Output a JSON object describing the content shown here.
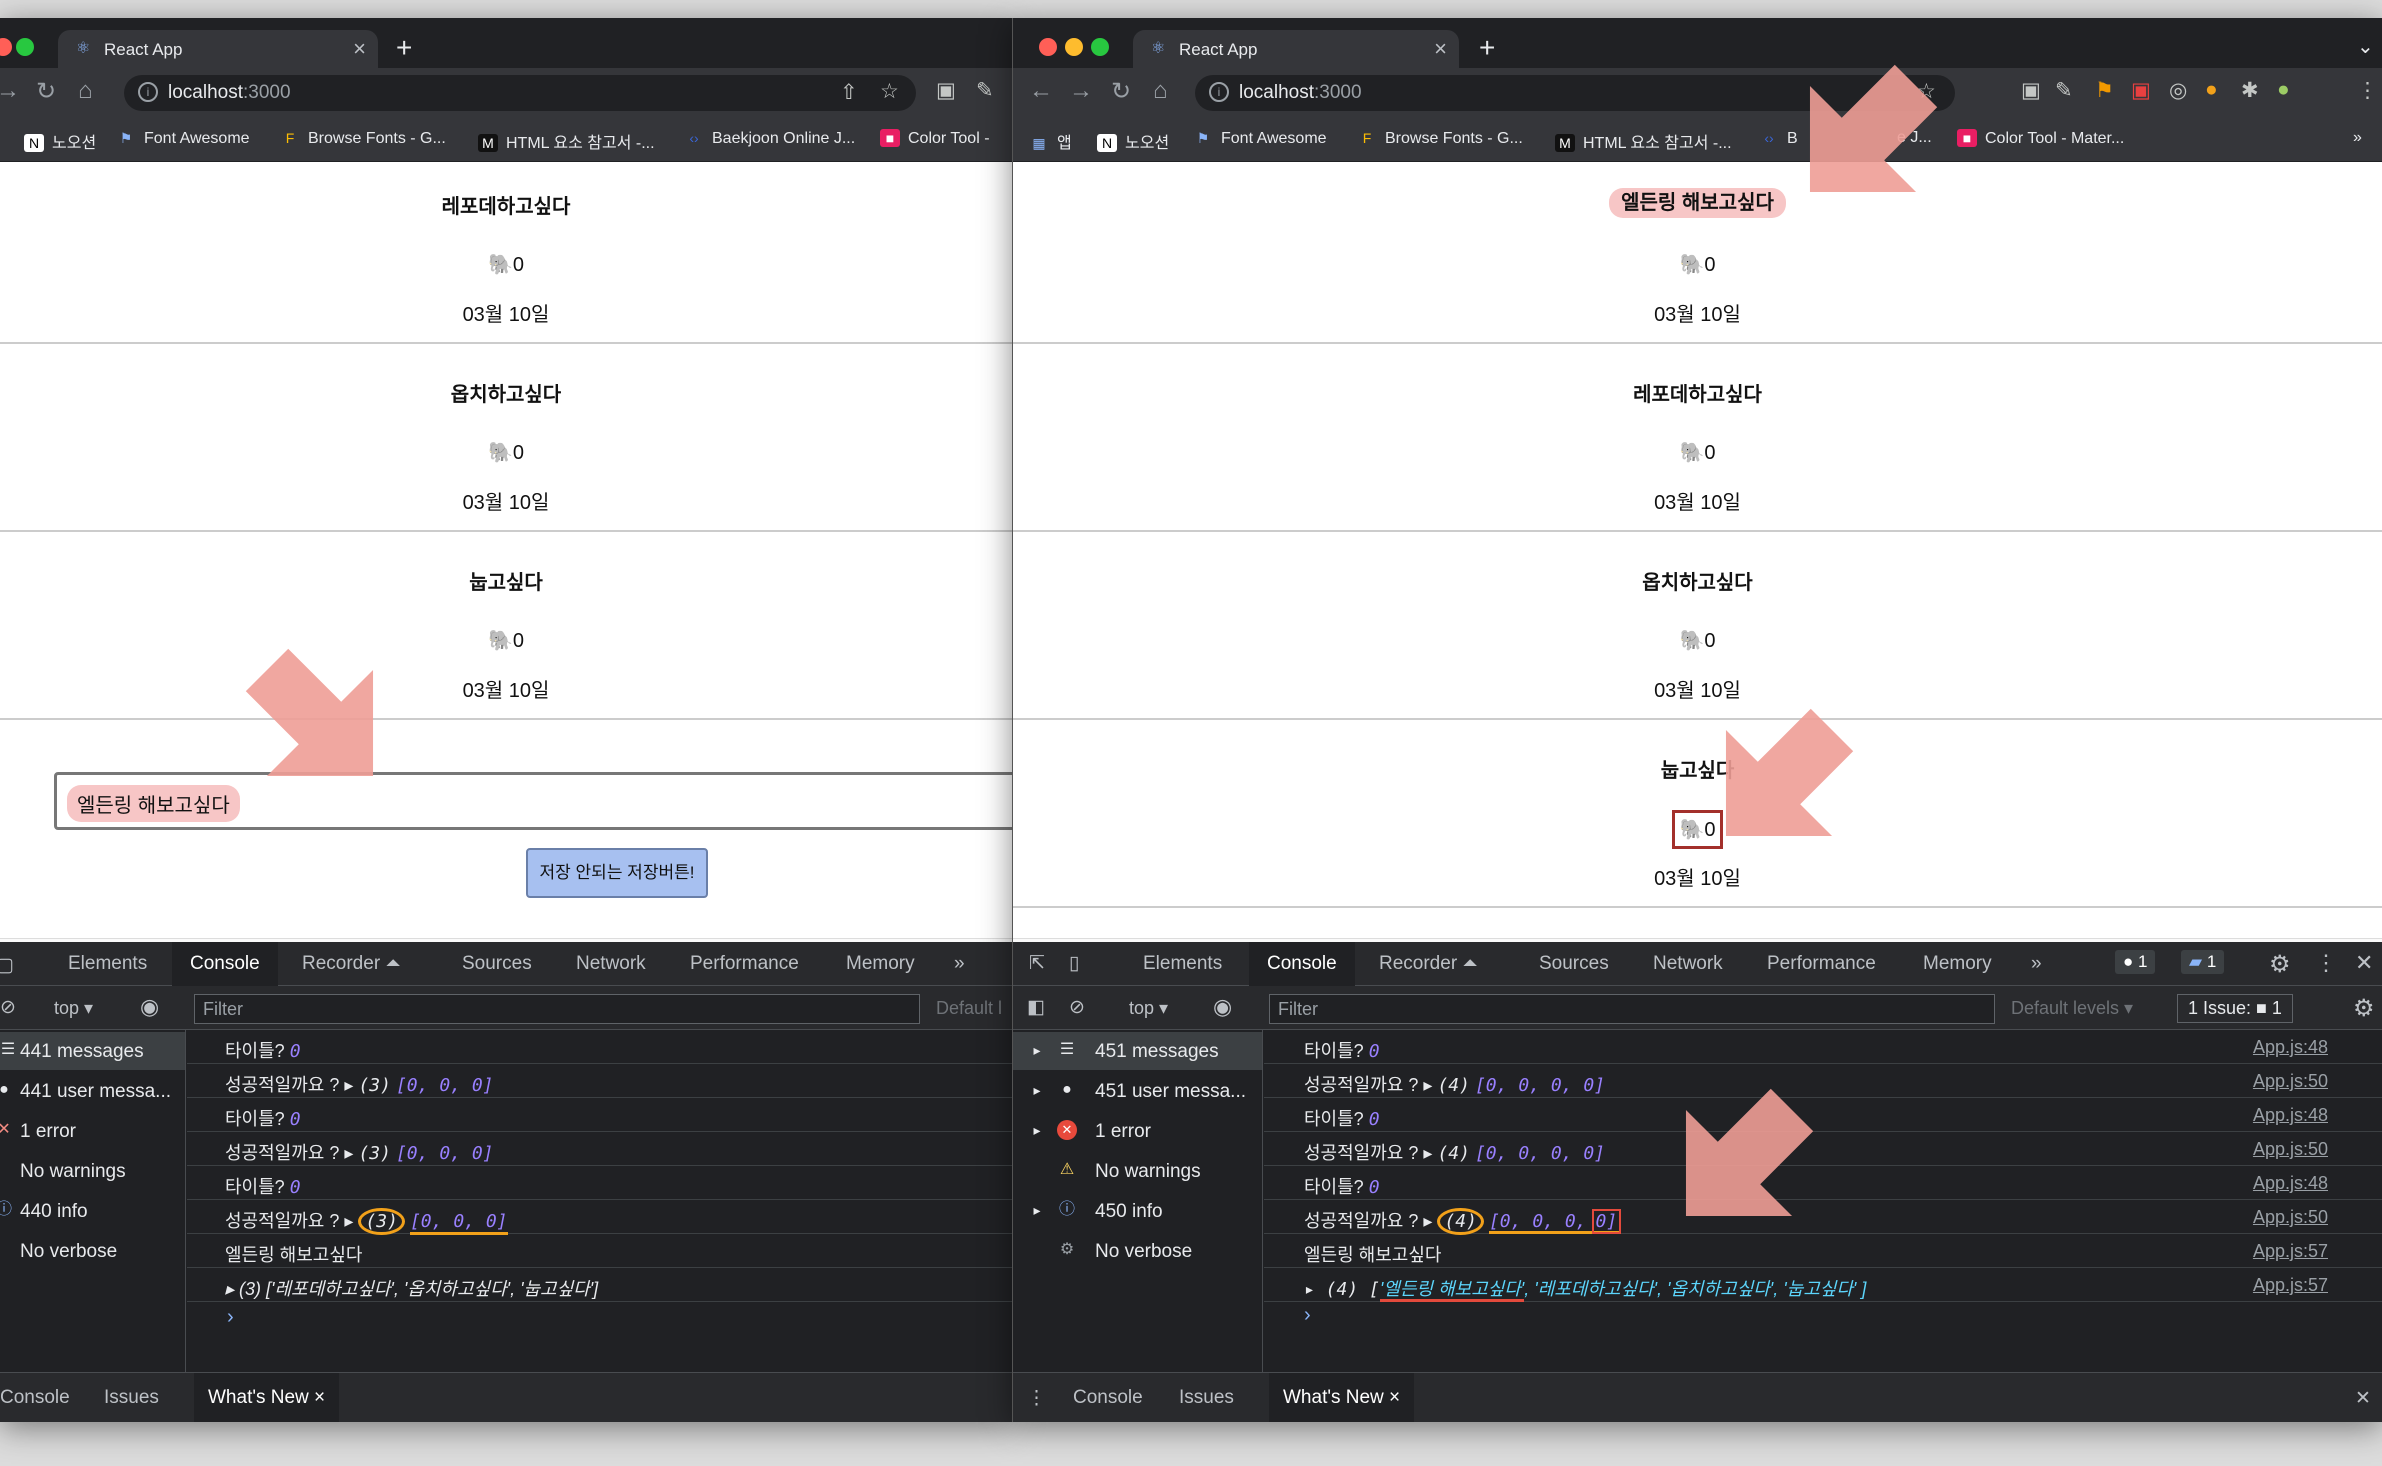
{
  "left_window": {
    "tab_title": "React App",
    "address": {
      "host": "localhost",
      "port": ":3000"
    },
    "bookmarks": [
      "노오션",
      "Font Awesome",
      "Browse Fonts - G...",
      "HTML 요소 참고서 -...",
      "Baekjoon Online J...",
      "Color Tool -"
    ],
    "posts": [
      {
        "title": "레포데하고싶다",
        "likes": "🐘0",
        "date": "03월 10일"
      },
      {
        "title": "옵치하고싶다",
        "likes": "🐘0",
        "date": "03월 10일"
      },
      {
        "title": "눕고싶다",
        "likes": "🐘0",
        "date": "03월 10일"
      }
    ],
    "input_value": "엘든링 해보고싶다",
    "save_button": "저장 안되는 저장버튼!",
    "devtools": {
      "tabs": [
        "Elements",
        "Console",
        "Recorder ⏶",
        "Sources",
        "Network",
        "Performance",
        "Memory",
        "»"
      ],
      "context": "top ▾",
      "filter_placeholder": "Filter",
      "levels": "Default l",
      "sidebar": [
        {
          "icon": "☰",
          "label": "441 messages"
        },
        {
          "icon": "●",
          "label": "441 user messa..."
        },
        {
          "icon": "✕",
          "label": "1 error"
        },
        {
          "icon": "⚠",
          "label": "No warnings"
        },
        {
          "icon": "ⓘ",
          "label": "440 info"
        },
        {
          "icon": "⚙",
          "label": "No verbose"
        }
      ],
      "log": [
        {
          "label": "타이틀?",
          "value": "0"
        },
        {
          "label": "성공적일까요 ? ▸",
          "count": "(3)",
          "array": "[0, 0, 0]"
        },
        {
          "label": "타이틀?",
          "value": "0"
        },
        {
          "label": "성공적일까요 ? ▸",
          "count": "(3)",
          "array": "[0, 0, 0]"
        },
        {
          "label": "타이틀?",
          "value": "0"
        },
        {
          "label": "성공적일까요 ? ▸",
          "count": "(3)",
          "array": "[0, 0, 0]"
        },
        {
          "label": "엘든링 해보고싶다"
        },
        {
          "label": "▸ (3) ['레포데하고싶다', '옵치하고싶다', '눕고싶다']"
        }
      ],
      "drawer_tabs": [
        "Console",
        "Issues",
        "What's New ×"
      ]
    }
  },
  "right_window": {
    "tab_title": "React App",
    "address": {
      "host": "localhost",
      "port": ":3000"
    },
    "bookmarks": [
      "앱",
      "노오션",
      "Font Awesome",
      "Browse Fonts - G...",
      "HTML 요소 참고서 -...",
      "B",
      "e J...",
      "Color Tool - Mater..."
    ],
    "posts": [
      {
        "title": "엘든링 해보고싶다",
        "likes": "🐘0",
        "date": "03월 10일"
      },
      {
        "title": "레포데하고싶다",
        "likes": "🐘0",
        "date": "03월 10일"
      },
      {
        "title": "옵치하고싶다",
        "likes": "🐘0",
        "date": "03월 10일"
      },
      {
        "title": "눕고싶다",
        "likes": "🐘0",
        "date": "03월 10일"
      }
    ],
    "devtools": {
      "tabs": [
        "Elements",
        "Console",
        "Recorder ⏶",
        "Sources",
        "Network",
        "Performance",
        "Memory",
        "»"
      ],
      "error_badge": "1",
      "issue_badge": "1",
      "context": "top ▾",
      "filter_placeholder": "Filter",
      "levels": "Default levels ▾",
      "issues": "1 Issue: ■ 1",
      "sidebar": [
        {
          "icon": "☰",
          "label": "451 messages"
        },
        {
          "icon": "●",
          "label": "451 user messa..."
        },
        {
          "icon": "✕",
          "label": "1 error"
        },
        {
          "icon": "⚠",
          "label": "No warnings"
        },
        {
          "icon": "ⓘ",
          "label": "450 info"
        },
        {
          "icon": "⚙",
          "label": "No verbose"
        }
      ],
      "log": [
        {
          "label": "타이틀?",
          "value": "0",
          "src": "App.js:48"
        },
        {
          "label": "성공적일까요 ? ▸",
          "count": "(4)",
          "array": "[0, 0, 0, 0]",
          "src": "App.js:50"
        },
        {
          "label": "타이틀?",
          "value": "0",
          "src": "App.js:48"
        },
        {
          "label": "성공적일까요 ? ▸",
          "count": "(4)",
          "array": "[0, 0, 0, 0]",
          "src": "App.js:50"
        },
        {
          "label": "타이틀?",
          "value": "0",
          "src": "App.js:48"
        },
        {
          "label": "성공적일까요 ? ▸",
          "count": "(4)",
          "array_head": "[0, 0, 0,",
          "array_last": "0]",
          "src": "App.js:50"
        },
        {
          "label": "엘든링 해보고싶다",
          "src": "App.js:57"
        },
        {
          "prefix": "▸ (4) [",
          "first": "'엘든링 해보고싶다'",
          "rest": ", '레포데하고싶다', '옵치하고싶다', '눕고싶다' ]",
          "src": "App.js:57"
        }
      ],
      "drawer_tabs": [
        "Console",
        "Issues",
        "What's New ×"
      ]
    }
  },
  "colors": {
    "highlight_pink": "#f7c6c6",
    "annotation_orange": "#f2a11a",
    "annotation_red": "#a3302b",
    "arrow": "#ee9d96"
  }
}
